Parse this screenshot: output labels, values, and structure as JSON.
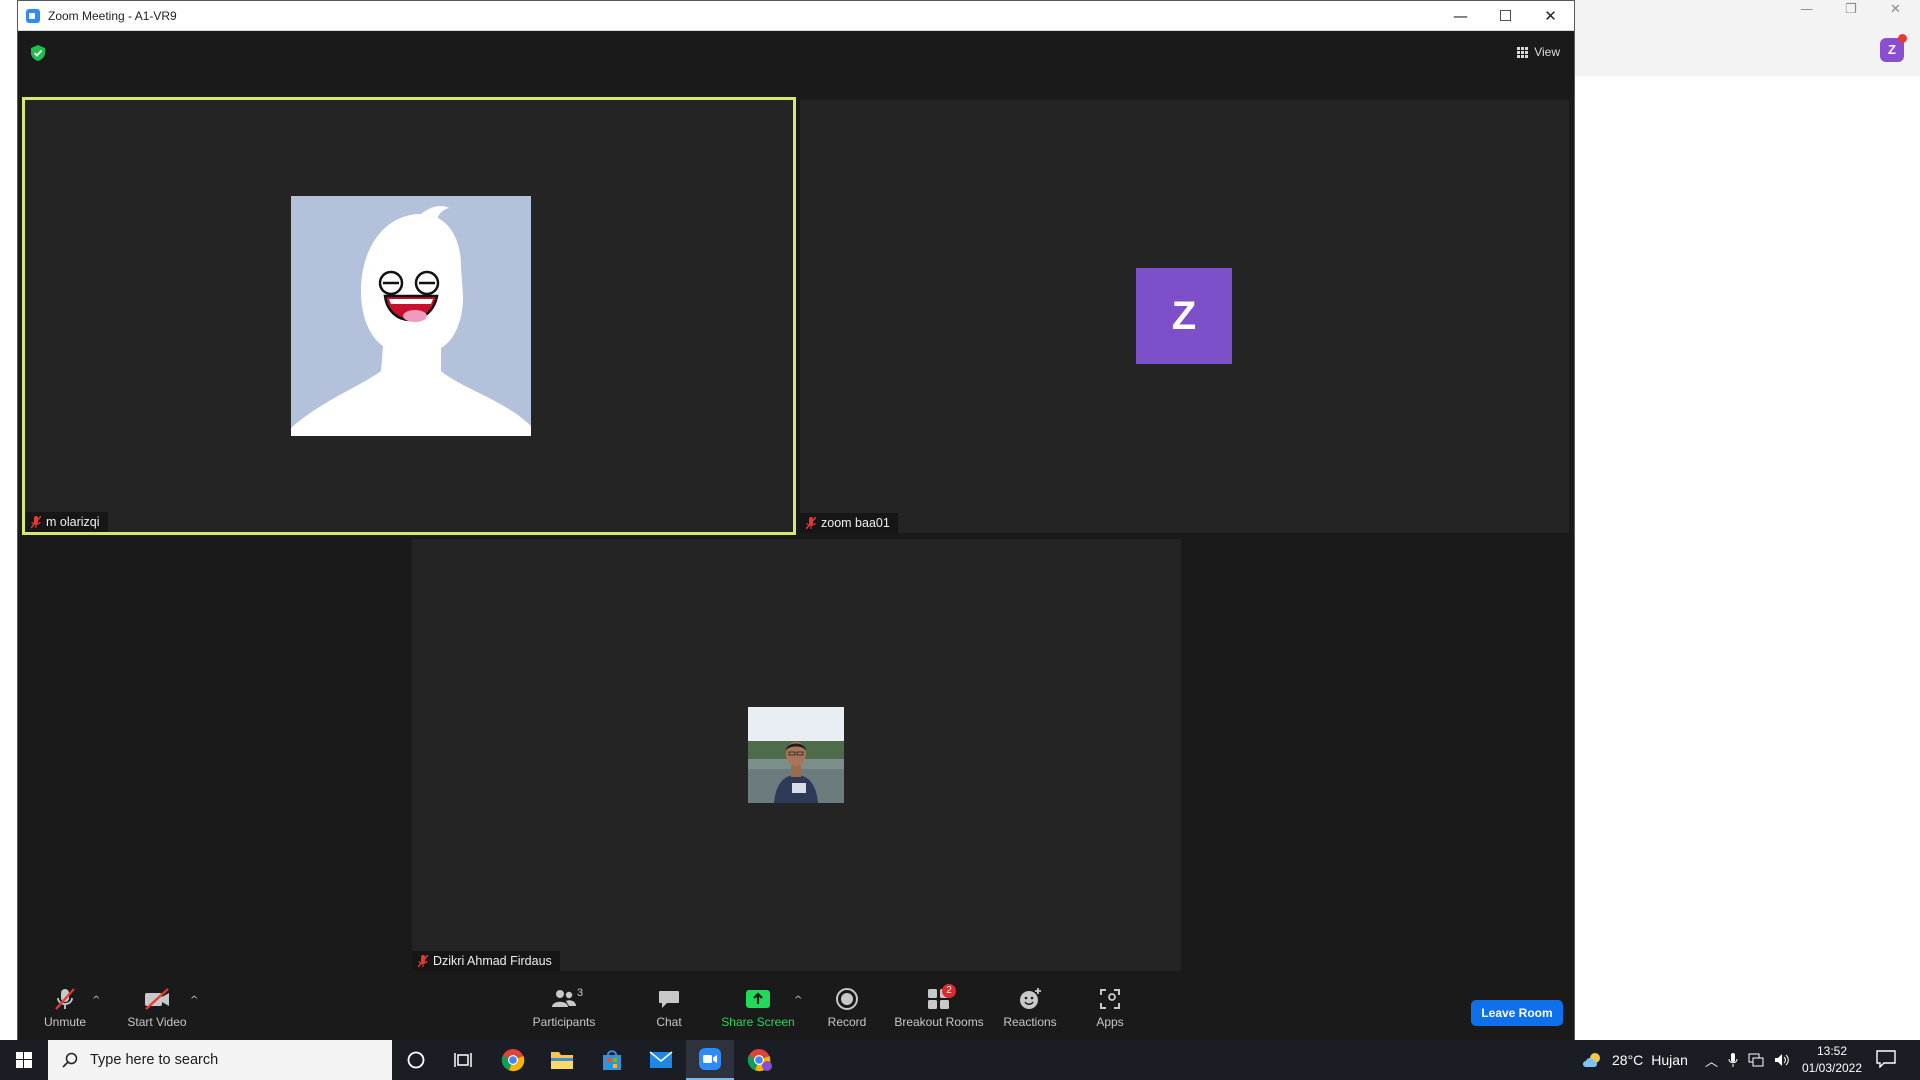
{
  "window": {
    "title": "Zoom Meeting - A1-VR9",
    "minimize_glyph": "—",
    "maximize_glyph": "☐",
    "close_glyph": "✕"
  },
  "top": {
    "view_label": "View"
  },
  "participants": [
    {
      "name": "m olarizqi",
      "muted": true,
      "active_speaker": true
    },
    {
      "name": "zoom baa01",
      "muted": true,
      "initial": "Z",
      "avatar_color": "#7d4fc8"
    },
    {
      "name": "Dzikri Ahmad Firdaus",
      "muted": true
    }
  ],
  "toolbar": {
    "unmute": "Unmute",
    "start_video": "Start Video",
    "participants": "Participants",
    "participants_count": "3",
    "chat": "Chat",
    "share_screen": "Share Screen",
    "record": "Record",
    "breakout_rooms": "Breakout Rooms",
    "breakout_count": "2",
    "reactions": "Reactions",
    "apps": "Apps",
    "leave": "Leave Room",
    "caret": "^"
  },
  "taskbar": {
    "search_placeholder": "Type here to search",
    "weather_temp": "28°C",
    "weather_text": "Hujan",
    "time": "13:52",
    "date": "01/03/2022"
  },
  "background_app": {
    "avatar_initial": "Z"
  },
  "colors": {
    "active_speaker_border": "#d8e86a",
    "leave_button": "#0e71eb",
    "share_green": "#23d959",
    "badge_red": "#e02828"
  }
}
